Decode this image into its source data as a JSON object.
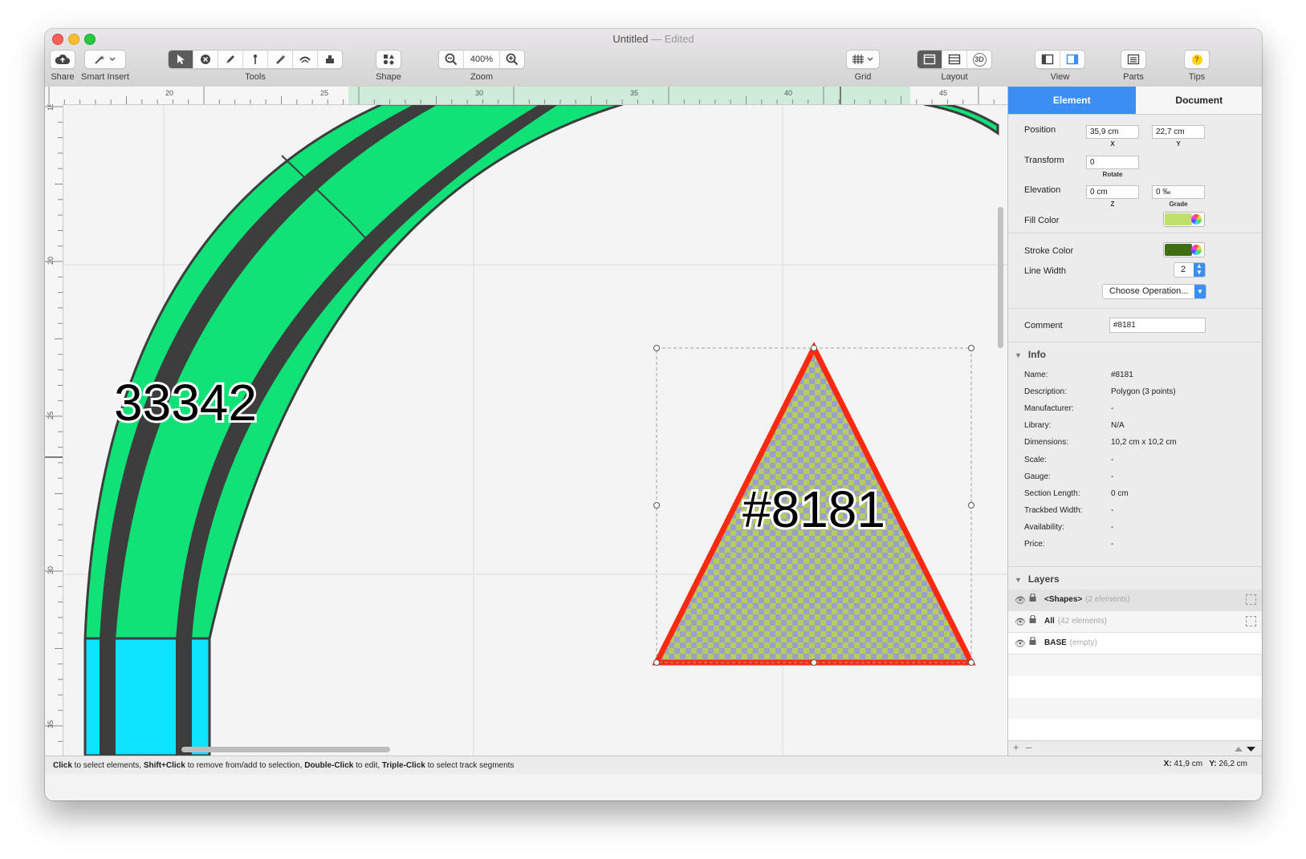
{
  "window": {
    "title": "Untitled",
    "title_suffix": " — Edited"
  },
  "toolbar": {
    "share_label": "Share",
    "smart_insert_label": "Smart Insert",
    "tools_label": "Tools",
    "shape_label": "Shape",
    "zoom_label": "Zoom",
    "zoom_value": "400%",
    "grid_label": "Grid",
    "layout_label": "Layout",
    "view_label": "View",
    "parts_label": "Parts",
    "tips_label": "Tips",
    "layout_3d": "3D",
    "tips_icon": "?"
  },
  "rulers": {
    "h_labels": [
      "20",
      "25",
      "30",
      "35",
      "40",
      "45"
    ],
    "v_labels": [
      "15",
      "20",
      "25",
      "30",
      "35"
    ]
  },
  "canvas": {
    "track_label": "33342",
    "shape_label": "#8181"
  },
  "status": {
    "hint": [
      {
        "text": "Click",
        "bold": true
      },
      {
        "text": " to select elements, ",
        "bold": false
      },
      {
        "text": "Shift+Click",
        "bold": true
      },
      {
        "text": " to remove from/add to selection, ",
        "bold": false
      },
      {
        "text": "Double-Click",
        "bold": true
      },
      {
        "text": " to edit, ",
        "bold": false
      },
      {
        "text": "Triple-Click",
        "bold": true
      },
      {
        "text": " to select track segments",
        "bold": false
      }
    ],
    "coord_x_label": "X:",
    "coord_x": "41,9 cm",
    "coord_y_label": "Y:",
    "coord_y": "26,2 cm"
  },
  "inspector": {
    "tab_element": "Element",
    "tab_document": "Document",
    "position_label": "Position",
    "position_x": "35,9 cm",
    "position_y": "22,7 cm",
    "x_sublabel": "X",
    "y_sublabel": "Y",
    "transform_label": "Transform",
    "rotate_value": "0",
    "rotate_sublabel": "Rotate",
    "elevation_label": "Elevation",
    "elevation_z": "0 cm",
    "elevation_grade": "0 ‰",
    "z_sublabel": "Z",
    "grade_sublabel": "Grade",
    "fill_color_label": "Fill Color",
    "fill_color": "#bfe06b",
    "stroke_color_label": "Stroke Color",
    "stroke_color": "#3f6f12",
    "line_width_label": "Line Width",
    "line_width_value": "2",
    "operation_placeholder": "Choose Operation...",
    "comment_label": "Comment",
    "comment_value": "#8181",
    "info_title": "Info",
    "info": [
      {
        "k": "Name:",
        "v": "#8181"
      },
      {
        "k": "Description:",
        "v": "Polygon (3 points)"
      },
      {
        "k": "Manufacturer:",
        "v": "-"
      },
      {
        "k": "Library:",
        "v": "N/A"
      },
      {
        "k": "Dimensions:",
        "v": "10,2 cm x 10,2 cm"
      },
      {
        "k": "Scale:",
        "v": "-"
      },
      {
        "k": "Gauge:",
        "v": "-"
      },
      {
        "k": "Section Length:",
        "v": "0 cm"
      },
      {
        "k": "Trackbed Width:",
        "v": "-"
      },
      {
        "k": "Availability:",
        "v": "-"
      },
      {
        "k": "Price:",
        "v": "-"
      }
    ],
    "layers_title": "Layers",
    "layers": [
      {
        "name": "<Shapes>",
        "count": "(2 elements)"
      },
      {
        "name": "All",
        "count": "(42 elements)"
      },
      {
        "name": "BASE",
        "count": "(empty)"
      }
    ],
    "add_symbol": "+",
    "remove_symbol": "–"
  },
  "colors": {
    "track_green": "#10e278",
    "track_rail": "#3d3d3d",
    "track_cyan": "#0de4ff",
    "shape_stroke": "#ff2a10",
    "shape_fill_a": "#b6cc5c",
    "shape_fill_b": "#9aa0cc",
    "accent": "#3d8ef2"
  }
}
